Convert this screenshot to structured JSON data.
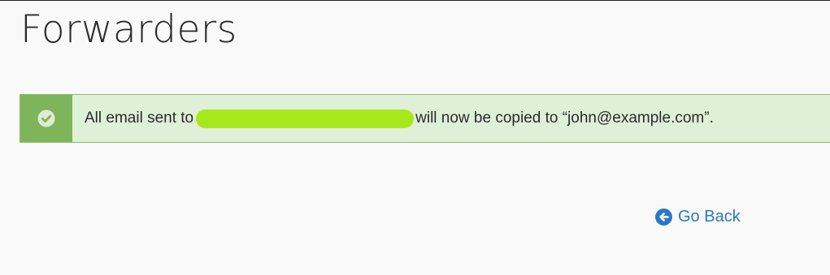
{
  "page": {
    "title": "Forwarders"
  },
  "alert": {
    "type": "success",
    "icon": "check-circle-icon",
    "text_before": "All email sent to",
    "text_after": "will now be copied to “john@example.com”."
  },
  "actions": {
    "go_back_label": "Go Back",
    "go_back_icon": "arrow-left-circle-icon"
  },
  "colors": {
    "alert_background": "#dff0d8",
    "alert_icon_cell": "#7fb55a",
    "link": "#2d78c5",
    "redaction": "#a7e81c"
  }
}
